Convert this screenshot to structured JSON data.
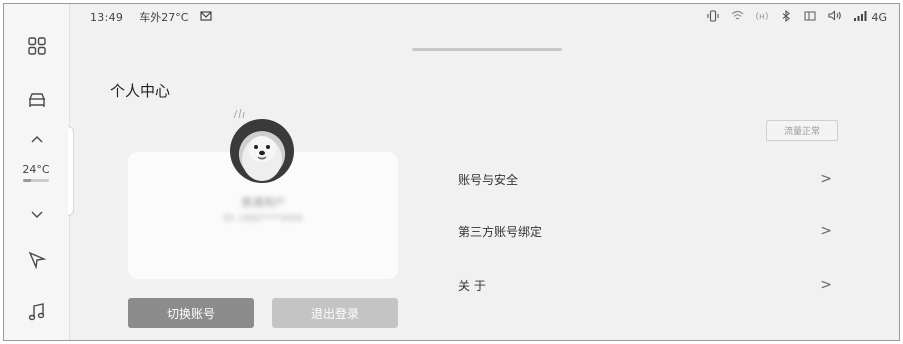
{
  "status_bar": {
    "time": "13:49",
    "outside_temp": "车外27°C",
    "network": "4G",
    "icons": [
      "mail-icon",
      "vibrate-icon",
      "wifi-icon",
      "hotspot-icon",
      "bluetooth-icon",
      "screen-icon",
      "volume-icon",
      "signal-icon"
    ]
  },
  "dock": {
    "items": [
      "apps-grid-icon",
      "car-icon",
      "chevron-up-icon",
      "chevron-down-icon",
      "navigation-icon",
      "music-icon"
    ],
    "temperature": "24°C"
  },
  "page": {
    "title": "个人中心"
  },
  "profile": {
    "username": "普通用户",
    "user_id": "ID: 1882****3456"
  },
  "buttons": {
    "switch_account": "切换账号",
    "logout": "退出登录"
  },
  "badge": {
    "flow_status": "流量正常"
  },
  "menu": [
    {
      "label": "账号与安全",
      "chevron": ">"
    },
    {
      "label": "第三方账号绑定",
      "chevron": ">"
    },
    {
      "label": "关 于",
      "chevron": ">"
    }
  ],
  "colors": {
    "background": "#f1f1f1",
    "primary_button": "#8c8c8c",
    "secondary_button": "#c4c4c4"
  }
}
